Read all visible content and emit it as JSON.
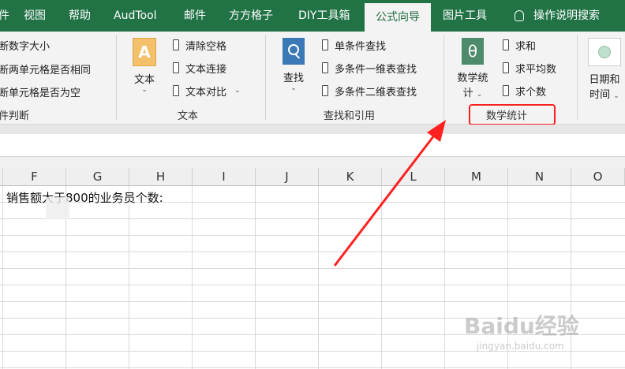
{
  "tabs": [
    {
      "label": "件",
      "active": false
    },
    {
      "label": "视图",
      "active": false
    },
    {
      "label": "帮助",
      "active": false
    },
    {
      "label": "AudTool",
      "active": false
    },
    {
      "label": "邮件",
      "active": false
    },
    {
      "label": "方方格子",
      "active": false
    },
    {
      "label": "DIY工具箱",
      "active": false
    },
    {
      "label": "公式向导",
      "active": true
    },
    {
      "label": "图片工具",
      "active": false
    },
    {
      "label": "操作说明搜索",
      "active": false
    }
  ],
  "ribbon": {
    "group_judge": {
      "items": [
        "断数字大小",
        "断两单元格是否相同",
        "断单元格是否为空"
      ],
      "label": "件判断"
    },
    "group_text": {
      "big_button": "文本",
      "items": [
        "清除空格",
        "文本连接",
        "文本对比"
      ],
      "label": "文本"
    },
    "group_lookup": {
      "big_button": "查找",
      "items": [
        "单条件查找",
        "多条件一维表查找",
        "多条件二维表查找"
      ],
      "label": "查找和引用"
    },
    "group_math": {
      "big_button_line1": "数学统",
      "big_button_line2": "计",
      "items": [
        "求和",
        "求平均数",
        "求个数"
      ],
      "label": "数学统计"
    },
    "group_date": {
      "big_button_line1": "日期和",
      "big_button_line2": "时间"
    }
  },
  "columns": [
    "F",
    "G",
    "H",
    "I",
    "J",
    "K",
    "L",
    "M",
    "N",
    "O"
  ],
  "cell_text": "销售额大于800的业务员个数:",
  "watermark": "Baidu经验",
  "watermark_url": "jingyan.baidu.com",
  "colors": {
    "accent": "#217346",
    "highlight": "#ff2020"
  }
}
